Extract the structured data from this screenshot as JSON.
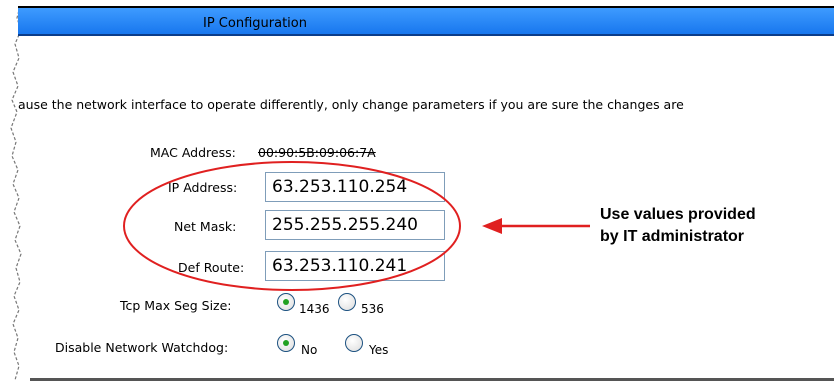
{
  "window": {
    "title": "IP Configuration"
  },
  "notice": "ause the network interface to operate differently, only change parameters if you are sure the changes are",
  "mac": {
    "label": "MAC Address:",
    "value": "00:90:5B:09:06:7A"
  },
  "fields": {
    "ip": {
      "label": "IP Address:",
      "value": "63.253.110.254"
    },
    "mask": {
      "label": "Net Mask:",
      "value": "255.255.255.240"
    },
    "route": {
      "label": "Def Route:",
      "value": "63.253.110.241"
    }
  },
  "tcp": {
    "label": "Tcp Max Seg Size:",
    "options": [
      {
        "label": "1436",
        "checked": true
      },
      {
        "label": "536",
        "checked": false
      }
    ]
  },
  "watchdog": {
    "label": "Disable Network Watchdog:",
    "options": [
      {
        "label": "No",
        "checked": true
      },
      {
        "label": "Yes",
        "checked": false
      }
    ]
  },
  "annotation": {
    "line1": "Use values provided",
    "line2": "by IT administrator"
  },
  "colors": {
    "title_bar": "#1877ee",
    "highlight": "#e02020",
    "radio_dot": "#21a121"
  }
}
